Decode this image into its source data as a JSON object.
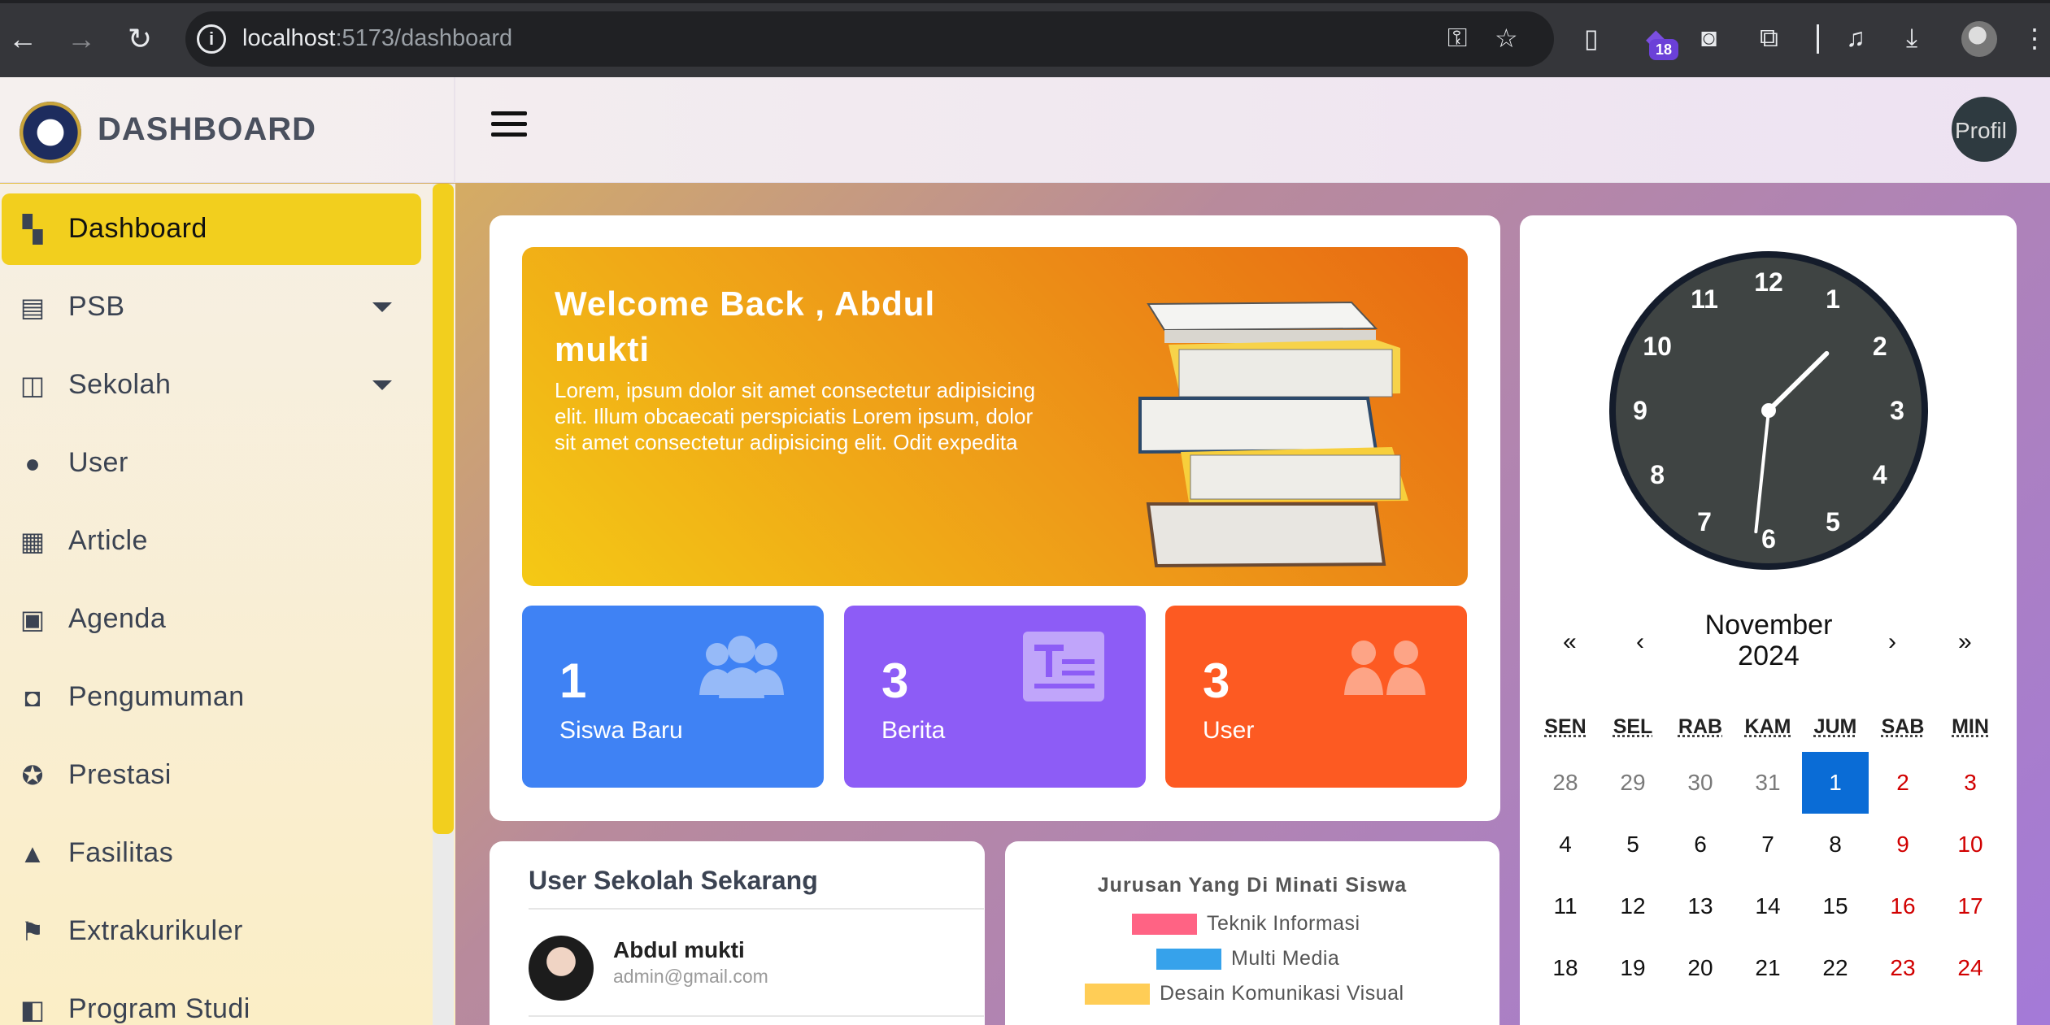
{
  "browser": {
    "url_host": "localhost",
    "url_path": ":5173/dashboard",
    "extension_badge": "18"
  },
  "app": {
    "brand": "DASHBOARD",
    "profile_alt": "Profil"
  },
  "sidebar": {
    "items": [
      {
        "label": "Dashboard",
        "icon": "dashboard-icon",
        "active": true
      },
      {
        "label": "PSB",
        "icon": "book-icon",
        "caret": true
      },
      {
        "label": "Sekolah",
        "icon": "open-book-icon",
        "caret": true
      },
      {
        "label": "User",
        "icon": "person-icon"
      },
      {
        "label": "Article",
        "icon": "newspaper-icon"
      },
      {
        "label": "Agenda",
        "icon": "calendar-icon"
      },
      {
        "label": "Pengumuman",
        "icon": "announcement-icon"
      },
      {
        "label": "Prestasi",
        "icon": "award-icon"
      },
      {
        "label": "Fasilitas",
        "icon": "service-bell-icon"
      },
      {
        "label": "Extrakurikuler",
        "icon": "activity-icon"
      },
      {
        "label": "Program Studi",
        "icon": "book-open-icon"
      }
    ]
  },
  "welcome": {
    "title": "Welcome Back , Abdul mukti",
    "text": "Lorem, ipsum dolor sit amet consectetur adipisicing elit. Illum obcaecati perspiciatis Lorem ipsum, dolor sit amet consectetur adipisicing elit. Odit expedita"
  },
  "stats": [
    {
      "value": "1",
      "label": "Siswa Baru",
      "color": "#3f82f4"
    },
    {
      "value": "3",
      "label": "Berita",
      "color": "#8d5cf6"
    },
    {
      "value": "3",
      "label": "User",
      "color": "#fd5a22"
    }
  ],
  "users_card": {
    "title": "User Sekolah Sekarang",
    "user": {
      "name": "Abdul mukti",
      "email": "admin@gmail.com"
    }
  },
  "chart_data": {
    "type": "pie",
    "title": "Jurusan Yang Di Minati Siswa",
    "legend": [
      {
        "name": "Teknik Informasi",
        "color": "#ff6384"
      },
      {
        "name": "Multi Media",
        "color": "#36a2eb"
      },
      {
        "name": "Desain Komunikasi Visual",
        "color": "#ffcd56"
      }
    ]
  },
  "clock": {
    "hour": 1,
    "minute": 31,
    "numbers": [
      "12",
      "1",
      "2",
      "3",
      "4",
      "5",
      "6",
      "7",
      "8",
      "9",
      "10",
      "11"
    ]
  },
  "calendar": {
    "month": "November",
    "year": "2024",
    "nav": [
      "«",
      "‹",
      "›",
      "»"
    ],
    "weekdays": [
      "SEN",
      "SEL",
      "RAB",
      "KAM",
      "JUM",
      "SAB",
      "MIN"
    ],
    "weeks": [
      [
        "28",
        "29",
        "30",
        "31",
        "1",
        "2",
        "3"
      ],
      [
        "4",
        "5",
        "6",
        "7",
        "8",
        "9",
        "10"
      ],
      [
        "11",
        "12",
        "13",
        "14",
        "15",
        "16",
        "17"
      ],
      [
        "18",
        "19",
        "20",
        "21",
        "22",
        "23",
        "24"
      ]
    ],
    "today": "1"
  }
}
